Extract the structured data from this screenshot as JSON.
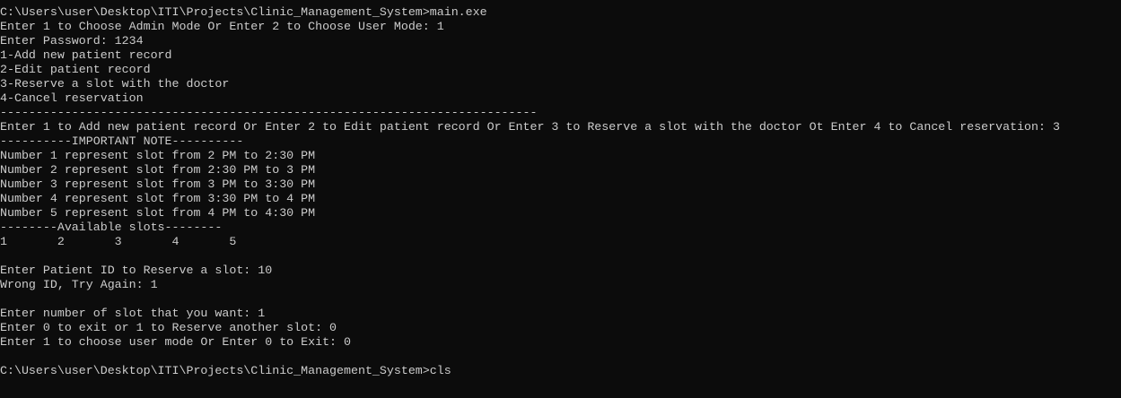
{
  "colors": {
    "background": "#0c0c0c",
    "foreground": "#cccccc"
  },
  "console": {
    "lines": [
      "C:\\Users\\user\\Desktop\\ITI\\Projects\\Clinic_Management_System>main.exe",
      "Enter 1 to Choose Admin Mode Or Enter 2 to Choose User Mode: 1",
      "Enter Password: 1234",
      "1-Add new patient record",
      "2-Edit patient record",
      "3-Reserve a slot with the doctor",
      "4-Cancel reservation",
      "---------------------------------------------------------------------------",
      "Enter 1 to Add new patient record Or Enter 2 to Edit patient record Or Enter 3 to Reserve a slot with the doctor Ot Enter 4 to Cancel reservation: 3",
      "----------IMPORTANT NOTE----------",
      "Number 1 represent slot from 2 PM to 2:30 PM",
      "Number 2 represent slot from 2:30 PM to 3 PM",
      "Number 3 represent slot from 3 PM to 3:30 PM",
      "Number 4 represent slot from 3:30 PM to 4 PM",
      "Number 5 represent slot from 4 PM to 4:30 PM",
      "--------Available slots--------",
      "1       2       3       4       5",
      "",
      "Enter Patient ID to Reserve a slot: 10",
      "Wrong ID, Try Again: 1",
      "",
      "Enter number of slot that you want: 1",
      "Enter 0 to exit or 1 to Reserve another slot: 0",
      "Enter 1 to choose user mode Or Enter 0 to Exit: 0",
      "",
      "C:\\Users\\user\\Desktop\\ITI\\Projects\\Clinic_Management_System>cls"
    ]
  }
}
